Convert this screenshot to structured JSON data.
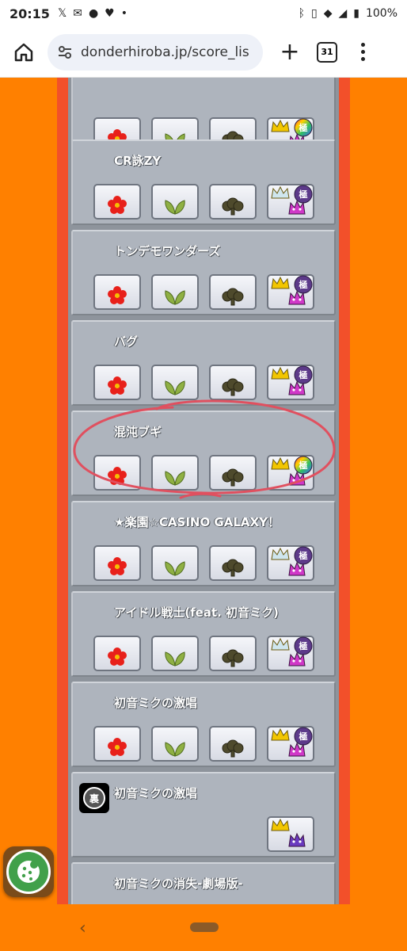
{
  "status_bar": {
    "time": "20:15",
    "battery": "100%"
  },
  "browser": {
    "url": "donderhiroba.jp/score_lis",
    "tab_count": "31"
  },
  "difficulty_icons": [
    "flower-icon",
    "leaf-icon",
    "tree-icon",
    "oni-icon"
  ],
  "songs": [
    {
      "title": "",
      "crown": "gold",
      "rank": "rainbow"
    },
    {
      "title": "CR詠ZY",
      "crown": "silver",
      "rank": "purple"
    },
    {
      "title": "トンデモワンダーズ",
      "crown": "gold",
      "rank": "purple"
    },
    {
      "title": "バグ",
      "crown": "gold",
      "rank": "purple"
    },
    {
      "title": "混沌ブギ",
      "crown": "gold",
      "rank": "rainbow"
    },
    {
      "title": "★楽園☆CASINO GALAXY！",
      "crown": "silver",
      "rank": "purple"
    },
    {
      "title": "アイドル戦士(feat. 初音ミク)",
      "crown": "silver",
      "rank": "purple"
    },
    {
      "title": "初音ミクの激唱",
      "crown": "gold",
      "rank": "purple"
    },
    {
      "title": "初音ミクの激唱",
      "crown": "gold",
      "rank": "none",
      "ura": true,
      "ura_label": "裏"
    },
    {
      "title": "初音ミクの消失-劇場版-"
    }
  ],
  "colors": {
    "page_bg": "#ff8000",
    "column_red": "#f2502a",
    "card_bg": "#aeb4bd",
    "annotation": "#e0505f"
  }
}
